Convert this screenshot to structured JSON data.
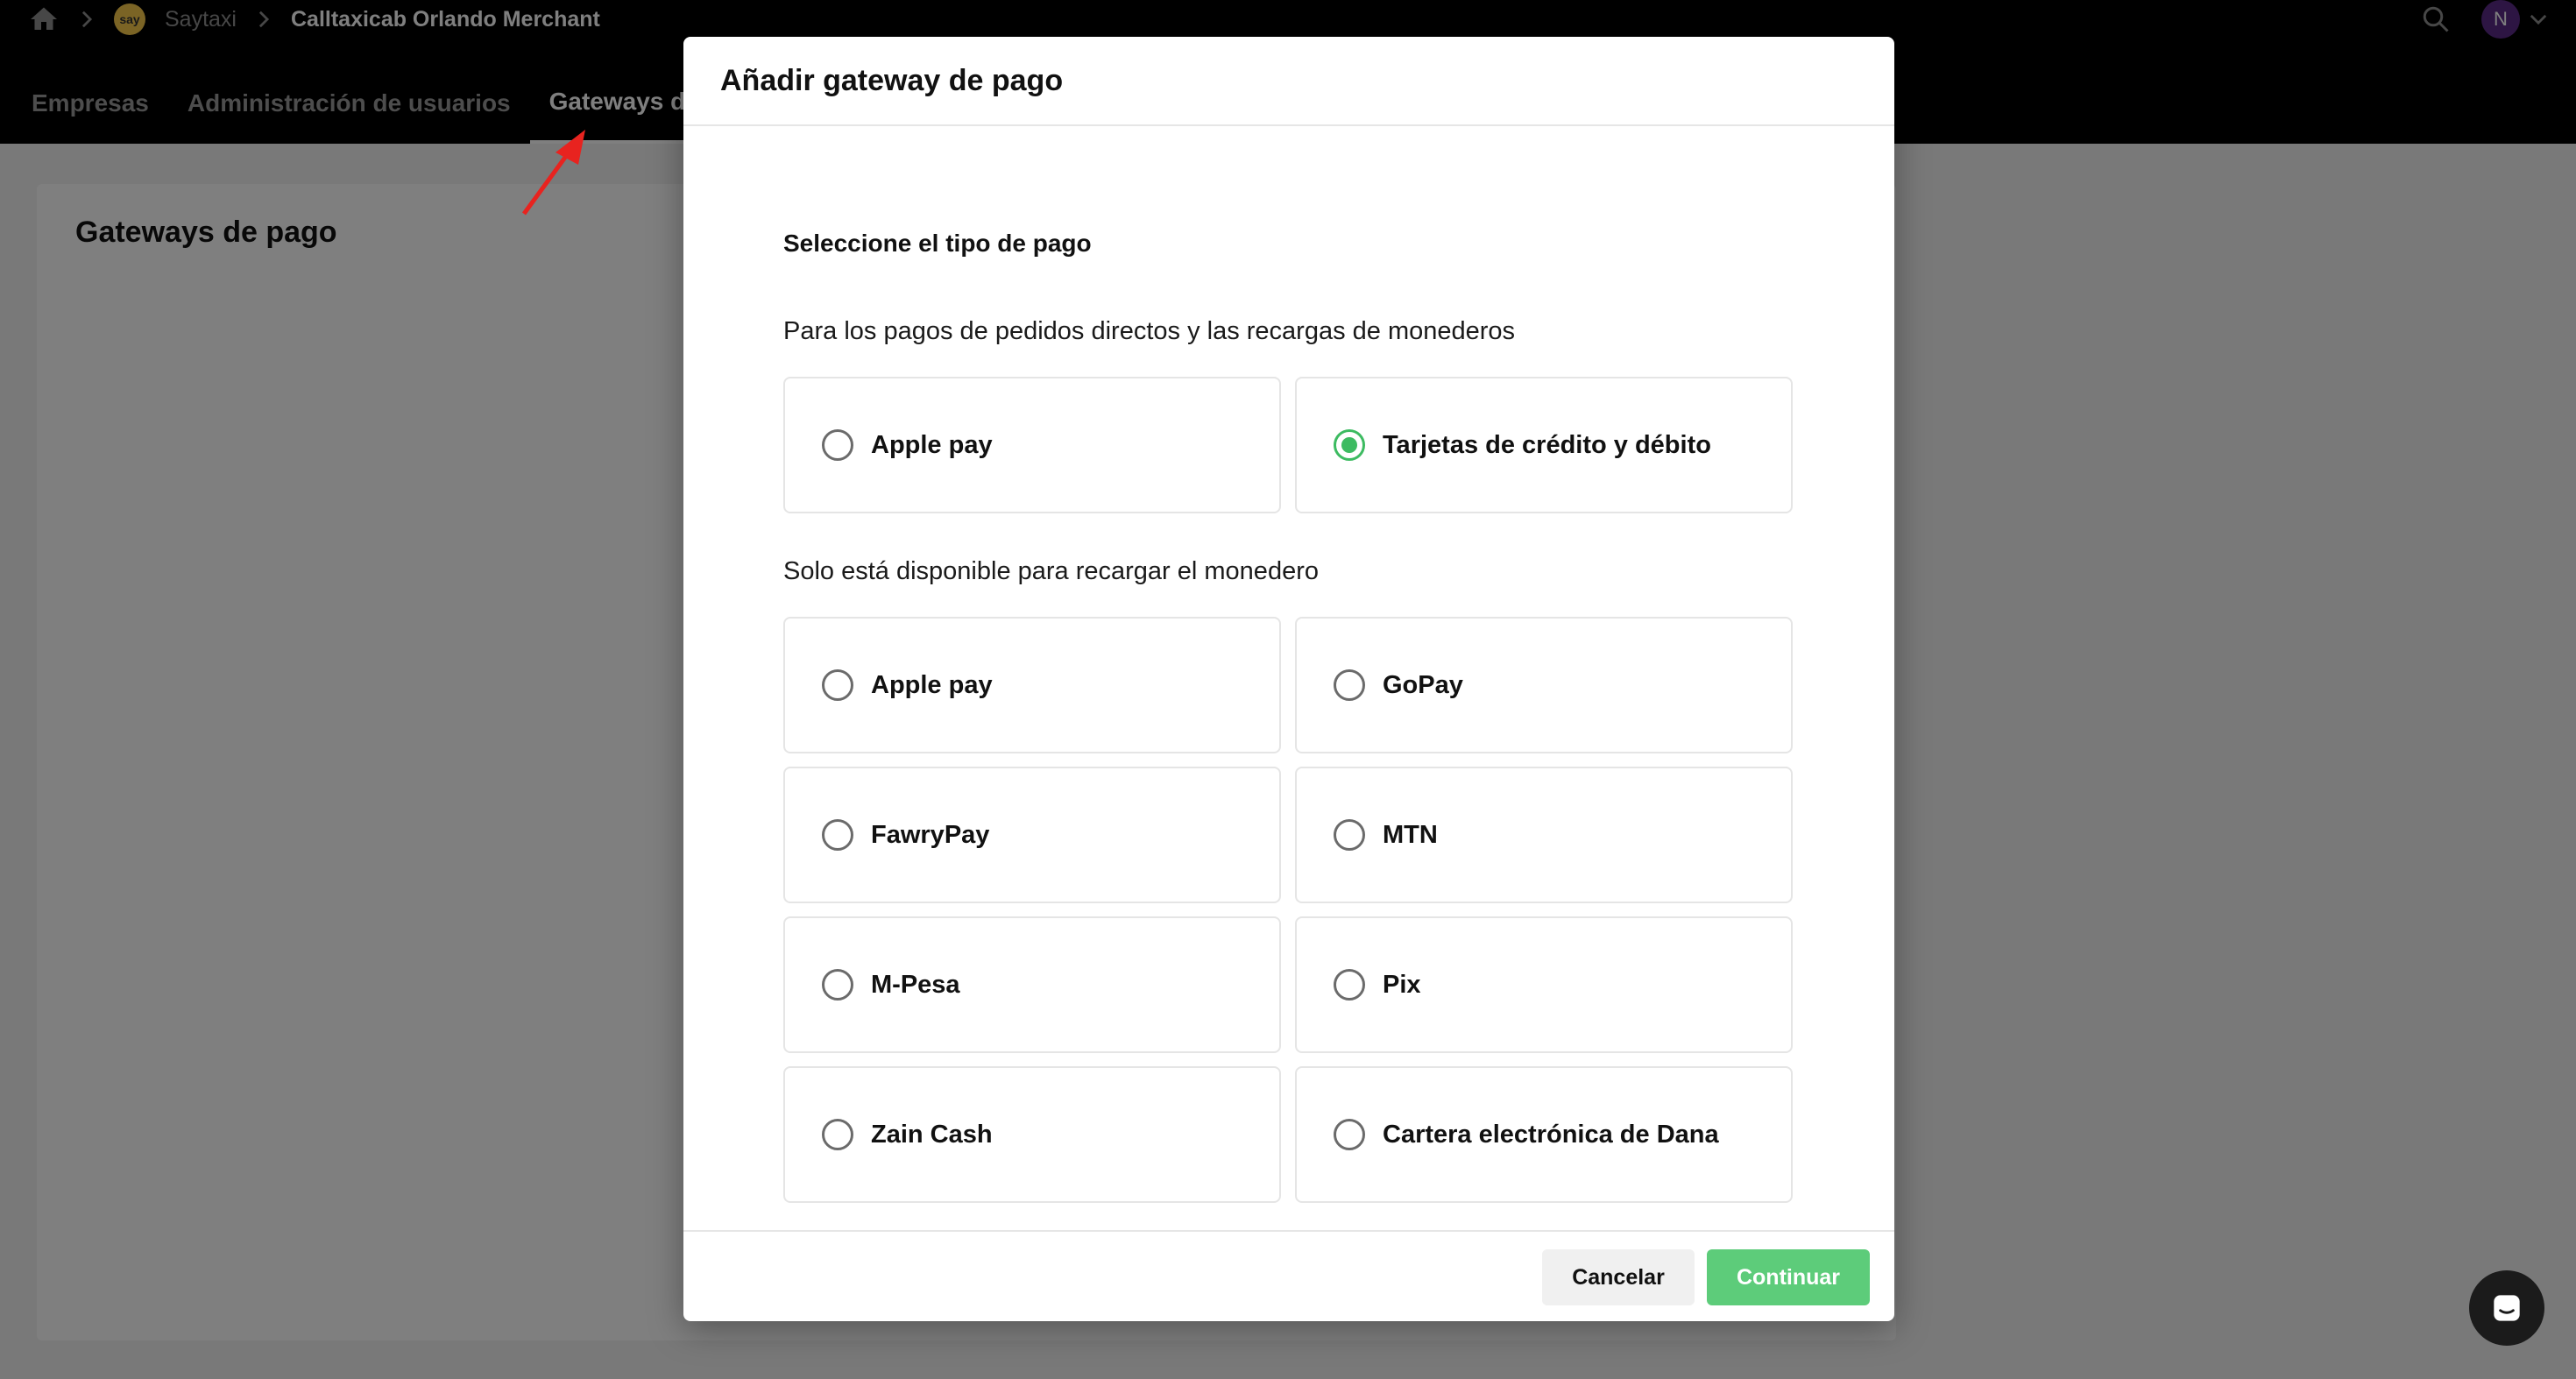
{
  "breadcrumb": {
    "org": "Saytaxi",
    "merchant": "Calltaxicab Orlando Merchant",
    "logo_text": "say"
  },
  "user": {
    "initial": "N"
  },
  "nav": {
    "tabs": [
      {
        "label": "Empresas"
      },
      {
        "label": "Administración de usuarios"
      },
      {
        "label": "Gateways de",
        "active": true
      }
    ]
  },
  "page": {
    "title": "Gateways de pago"
  },
  "modal": {
    "title": "Añadir gateway de pago",
    "select_label": "Seleccione el tipo de pago",
    "section_direct": {
      "label": "Para los pagos de pedidos directos y las recargas de monederos",
      "options": [
        {
          "label": "Apple pay",
          "checked": false
        },
        {
          "label": "Tarjetas de crédito y débito",
          "checked": true
        }
      ]
    },
    "section_wallet": {
      "label": "Solo está disponible para recargar el monedero",
      "options": [
        {
          "label": "Apple pay",
          "checked": false
        },
        {
          "label": "GoPay",
          "checked": false
        },
        {
          "label": "FawryPay",
          "checked": false
        },
        {
          "label": "MTN",
          "checked": false
        },
        {
          "label": "M-Pesa",
          "checked": false
        },
        {
          "label": "Pix",
          "checked": false
        },
        {
          "label": "Zain Cash",
          "checked": false
        },
        {
          "label": "Cartera electrónica de Dana",
          "checked": false
        }
      ]
    },
    "cancel_label": "Cancelar",
    "continue_label": "Continuar"
  },
  "colors": {
    "accent_green": "#3dbb61",
    "continue_button": "#5dcc7a",
    "annotation_arrow": "#e8231f",
    "topbar": "#000000"
  },
  "icons": [
    "home-icon",
    "chevron-right-icon",
    "search-icon",
    "chevron-down-icon",
    "chat-icon",
    "annotation-arrow"
  ]
}
